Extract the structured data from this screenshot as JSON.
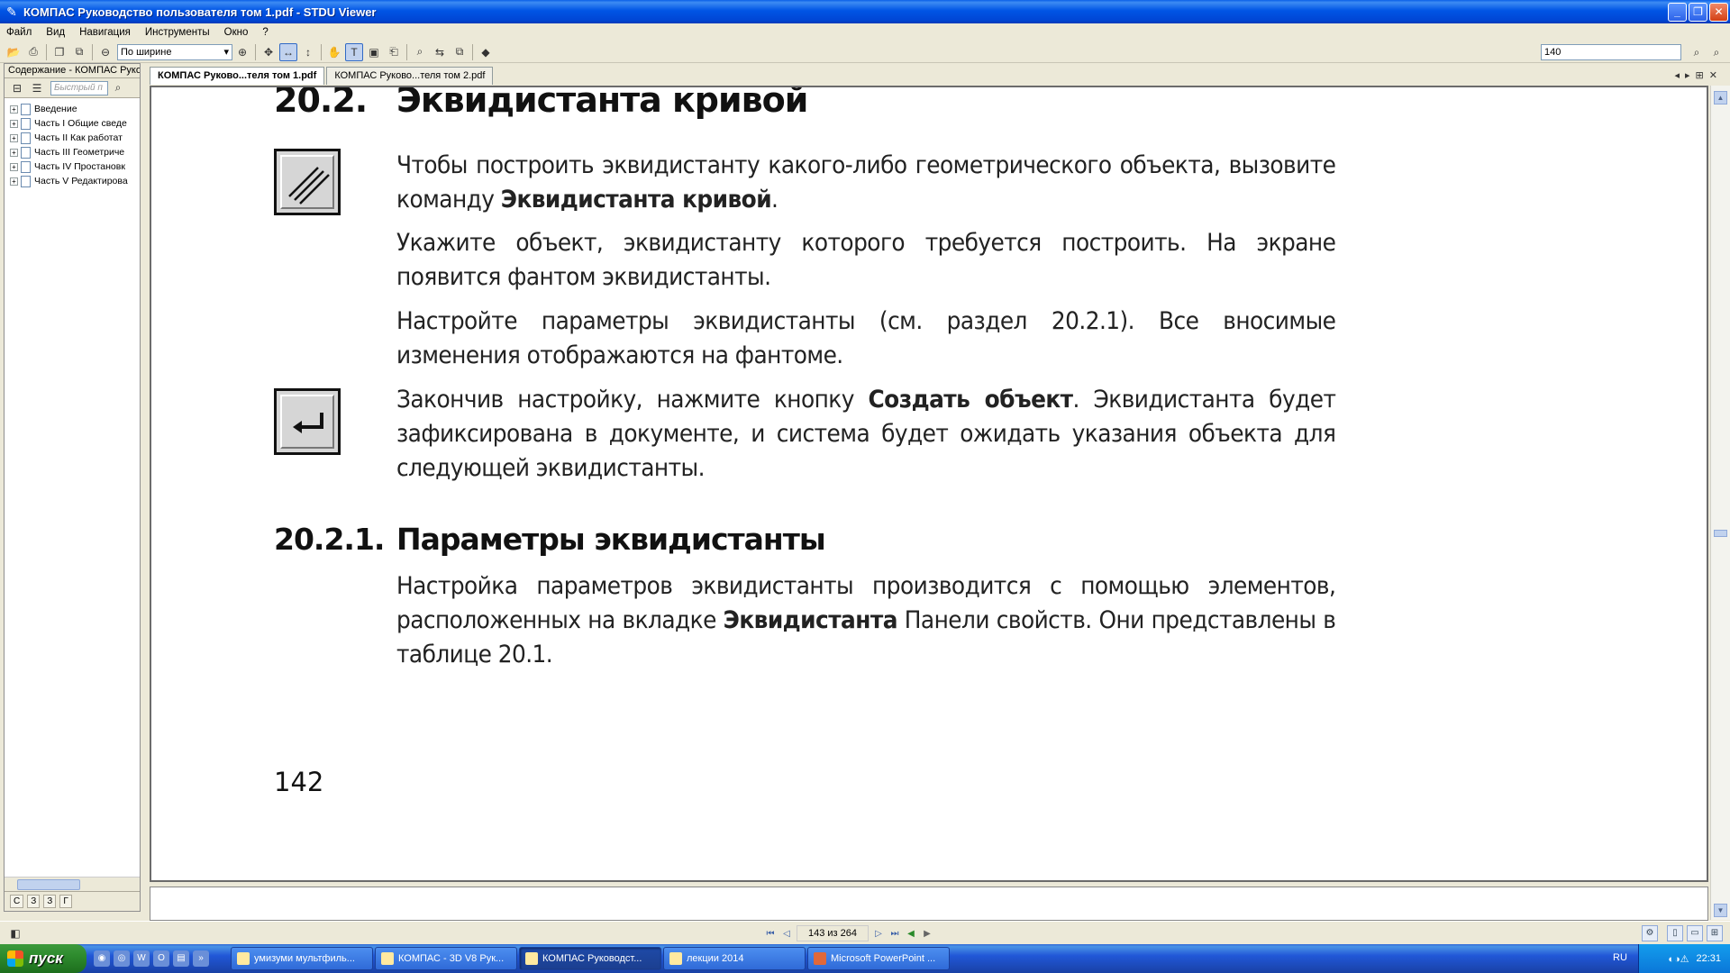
{
  "window": {
    "title": "КОМПАС Руководство пользователя том 1.pdf - STDU Viewer",
    "minimize": "_",
    "maximize": "❐",
    "close": "✕"
  },
  "menu": [
    "Файл",
    "Вид",
    "Навигация",
    "Инструменты",
    "Окно",
    "?"
  ],
  "toolbar": {
    "zoom_mode": "По ширине",
    "search_value": "140"
  },
  "left_panel": {
    "title": "Содержание - КОМПАС Руко",
    "quick_search_placeholder": "Быстрый п",
    "tree": [
      "Введение",
      "Часть I Общие сведе",
      "Часть II Как работат",
      "Часть III Геометриче",
      "Часть IV Простановк",
      "Часть V Редактирова"
    ],
    "bottom_tabs": [
      "С",
      "З",
      "З",
      "Г"
    ]
  },
  "tabs": [
    {
      "label": "КОМПАС Руково...теля том 1.pdf",
      "active": true
    },
    {
      "label": "КОМПАС Руково...теля том 2.pdf",
      "active": false
    }
  ],
  "page": {
    "section_num": "20.2.",
    "section_title": "Эквидистанта кривой",
    "p1_a": "Чтобы построить эквидистанту какого-либо геометрического объекта, вызовите команду ",
    "p1_b": "Эквидистанта кривой",
    "p1_c": ".",
    "p2": "Укажите объект, эквидистанту которого требуется построить. На экране появится фантом эквидистанты.",
    "p3": "Настройте параметры эквидистанты (см. раздел 20.2.1). Все вносимые изменения отображаются на фантоме.",
    "p4_a": "Закончив настройку, нажмите кнопку ",
    "p4_b": "Создать объект",
    "p4_c": ". Эквидистанта будет зафиксирована в документе, и система будет ожидать указания объекта для следующей эквидистанты.",
    "subsection_num": "20.2.1.",
    "subsection_title": "Параметры эквидистанты",
    "p5_a": "Настройка параметров эквидистанты производится с помощью элементов, расположенных на вкладке ",
    "p5_b": "Эквидистанта",
    "p5_c": " Панели свойств. Они представлены в таблице 20.1.",
    "page_number": "142"
  },
  "status": {
    "page_indicator": "143 из 264"
  },
  "taskbar": {
    "start": "пуск",
    "tasks": [
      {
        "label": "умизуми мультфиль...",
        "active": false
      },
      {
        "label": "КОМПАС - 3D V8 Рук...",
        "active": false
      },
      {
        "label": "КОМПАС Руководст...",
        "active": true
      },
      {
        "label": "лекции 2014",
        "active": false
      },
      {
        "label": "Microsoft PowerPoint ...",
        "active": false
      }
    ],
    "lang": "RU",
    "clock": "22:31"
  }
}
